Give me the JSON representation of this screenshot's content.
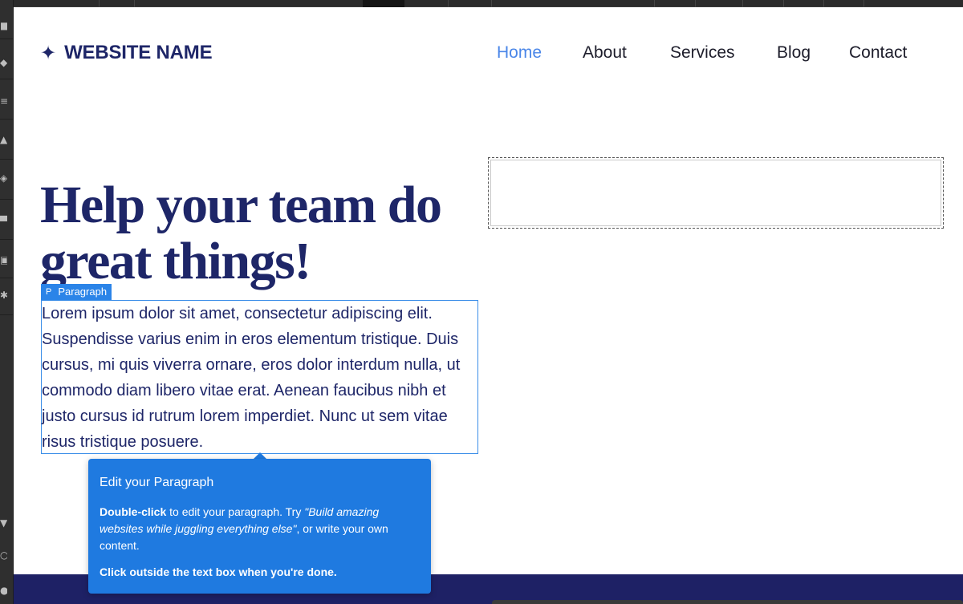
{
  "site": {
    "brand_icon": "sparkle-star-icon",
    "brand_name": "WEBSITE NAME",
    "nav": [
      {
        "label": "Home",
        "active": true
      },
      {
        "label": "About",
        "active": false
      },
      {
        "label": "Services",
        "active": false
      },
      {
        "label": "Blog",
        "active": false
      },
      {
        "label": "Contact",
        "active": false
      }
    ],
    "headline": "Help your team do great things!",
    "paragraph": "Lorem ipsum dolor sit amet, consectetur adipiscing elit. Suspendisse varius enim in eros elementum tristique. Duis cursus, mi quis viverra ornare, eros dolor interdum nulla, ut commodo diam libero vitae erat. Aenean faucibus nibh et justo cursus id rutrum lorem imperdiet. Nunc ut sem vitae risus tristique posuere."
  },
  "editor": {
    "selection_tag": {
      "glyph": "P",
      "label": "Paragraph"
    },
    "tooltip": {
      "title": "Edit your Paragraph",
      "body_bold": "Double-click",
      "body_text": " to edit your paragraph. Try ",
      "body_italic": "\"Build amazing websites while juggling everything else\"",
      "body_tail": ", or write your own content.",
      "footer": "Click outside the text box when you're done."
    }
  },
  "colors": {
    "brand_navy": "#1e2668",
    "nav_active": "#4a86e8",
    "editor_blue": "#1f7ae0",
    "footer_navy": "#1e2165"
  }
}
